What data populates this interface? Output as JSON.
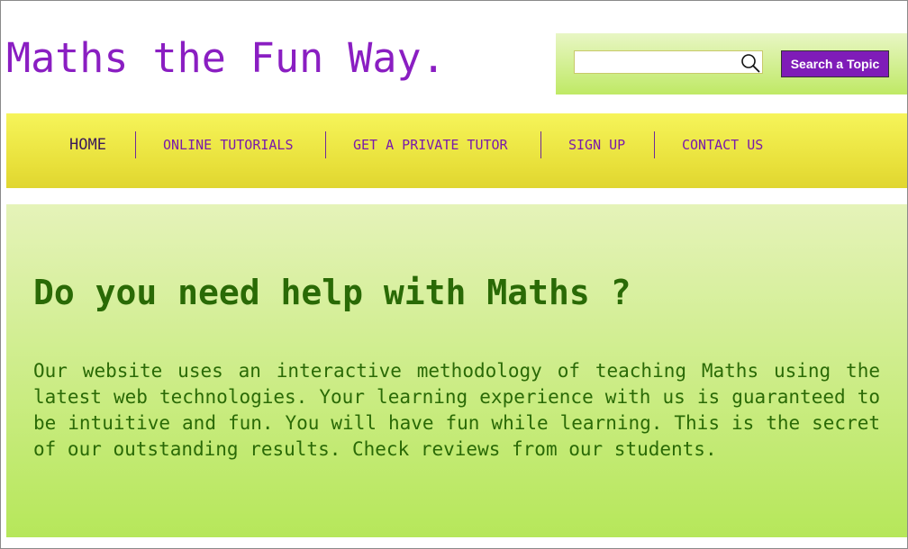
{
  "header": {
    "title": "Maths the Fun Way."
  },
  "search": {
    "placeholder": "",
    "value": "",
    "icon": "search-icon",
    "button_label": "Search a Topic"
  },
  "nav": {
    "items": [
      {
        "label": "HOME",
        "active": true
      },
      {
        "label": "ONLINE TUTORIALS",
        "active": false
      },
      {
        "label": "GET A PRIVATE TUTOR",
        "active": false
      },
      {
        "label": "SIGN UP",
        "active": false
      },
      {
        "label": "CONTACT US",
        "active": false
      }
    ]
  },
  "hero": {
    "heading": "Do you need help with Maths ?",
    "text": "Our website uses an interactive methodology of teaching Maths using the latest web technologies. Your learning experience with us is guaranteed to be intuitive and fun. You will have fun while learning. This is the secret of our outstanding results. Check reviews from our students."
  },
  "colors": {
    "brand_purple": "#8a1ec2",
    "nav_yellow": "#f6f45a",
    "hero_green": "#b6e75a",
    "text_green": "#2a6a06"
  }
}
